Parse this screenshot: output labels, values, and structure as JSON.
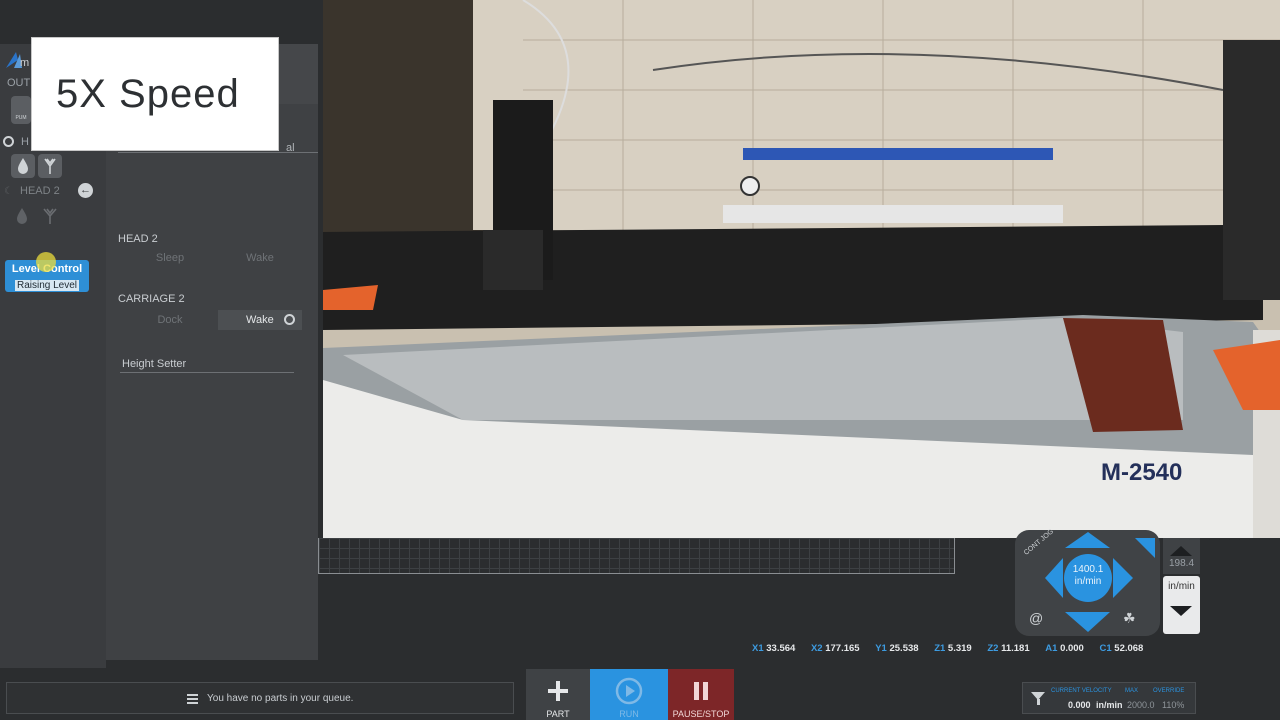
{
  "overlay": {
    "speed_text": "5X Speed"
  },
  "sidebar": {
    "out_label": "OUT",
    "pump_label": "PUM",
    "head1_label": "H",
    "head2_label": "HEAD 2",
    "level_control": {
      "title": "Level Control",
      "status": "Raising Level"
    }
  },
  "panel": {
    "truncated_label": "al",
    "head2": {
      "title": "HEAD 2",
      "sleep": "Sleep",
      "wake": "Wake"
    },
    "carriage2": {
      "title": "CARRIAGE 2",
      "dock": "Dock",
      "wake": "Wake"
    },
    "height_setter": "Height Setter"
  },
  "video": {
    "machine_label": "M-2540"
  },
  "jog": {
    "speed_value": "1400.1",
    "speed_unit": "in/min",
    "cont_label": "CONT",
    "jog_label": "JOG",
    "z_value": "198.4",
    "z_unit": "in/min"
  },
  "coords": [
    {
      "axis": "X1",
      "value": "33.564"
    },
    {
      "axis": "X2",
      "value": "177.165"
    },
    {
      "axis": "Y1",
      "value": "25.538"
    },
    {
      "axis": "Z1",
      "value": "5.319"
    },
    {
      "axis": "Z2",
      "value": "11.181"
    },
    {
      "axis": "A1",
      "value": "0.000"
    },
    {
      "axis": "C1",
      "value": "52.068"
    }
  ],
  "queue": {
    "message": "You have no parts in your queue."
  },
  "actions": {
    "part": "PART",
    "run": "RUN",
    "pause_stop": "PAUSE/STOP"
  },
  "velocity": {
    "current_label": "CURRENT VELOCITY",
    "max_label": "MAX",
    "override_label": "OVERRIDE",
    "current_value": "0.000",
    "unit": "in/min",
    "max_value": "2000.0",
    "override_value": "110%"
  },
  "colors": {
    "accent": "#2a93e0",
    "stop": "#7d2628",
    "level_control": "#2e8fd6"
  }
}
